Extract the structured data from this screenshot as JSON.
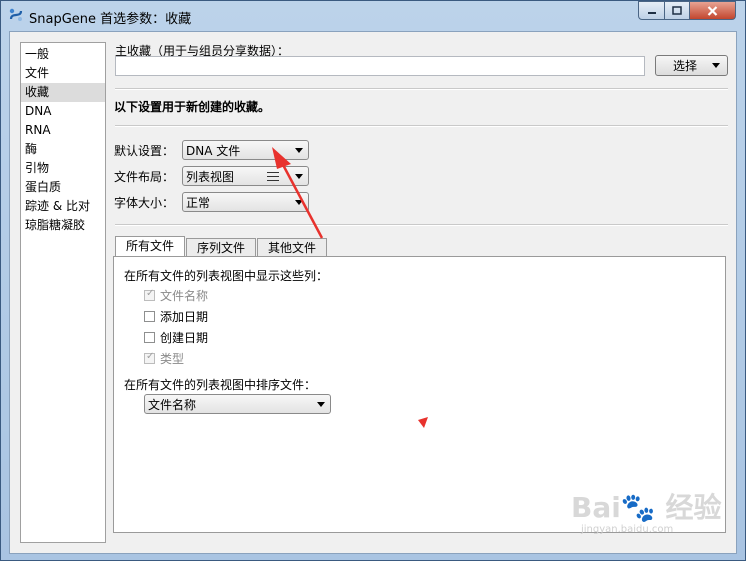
{
  "window": {
    "title": "SnapGene 首选参数：收藏"
  },
  "sidebar": {
    "items": [
      {
        "label": "一般"
      },
      {
        "label": "文件"
      },
      {
        "label": "收藏"
      },
      {
        "label": "DNA"
      },
      {
        "label": "RNA"
      },
      {
        "label": "酶"
      },
      {
        "label": "引物"
      },
      {
        "label": "蛋白质"
      },
      {
        "label": "踪迹 & 比对"
      },
      {
        "label": "琼脂糖凝胶"
      }
    ],
    "selected_index": 2
  },
  "main": {
    "main_favorites_label": "主收藏（用于与组员分享数据）：",
    "main_favorites_value": "",
    "choose_button": "选择",
    "new_favorites_heading": "以下设置用于新创建的收藏。",
    "default_settings_label": "默认设置：",
    "default_settings_value": "DNA 文件",
    "file_layout_label": "文件布局：",
    "file_layout_value": "列表视图",
    "font_size_label": "字体大小：",
    "font_size_value": "正常"
  },
  "tabs": [
    {
      "label": "所有文件",
      "active": true
    },
    {
      "label": "序列文件",
      "active": false
    },
    {
      "label": "其他文件",
      "active": false
    }
  ],
  "panel": {
    "columns_heading": "在所有文件的列表视图中显示这些列：",
    "checkboxes": [
      {
        "label": "文件名称",
        "checked": true,
        "disabled": true
      },
      {
        "label": "添加日期",
        "checked": false,
        "disabled": false
      },
      {
        "label": "创建日期",
        "checked": false,
        "disabled": false
      },
      {
        "label": "类型",
        "checked": true,
        "disabled": true
      }
    ],
    "sort_heading": "在所有文件的列表视图中排序文件：",
    "sort_value": "文件名称"
  },
  "colors": {
    "annotation_arrow": "#e8322d"
  },
  "watermark": {
    "text": "Bai 经验",
    "subtext": "jingyan.baidu.com"
  }
}
